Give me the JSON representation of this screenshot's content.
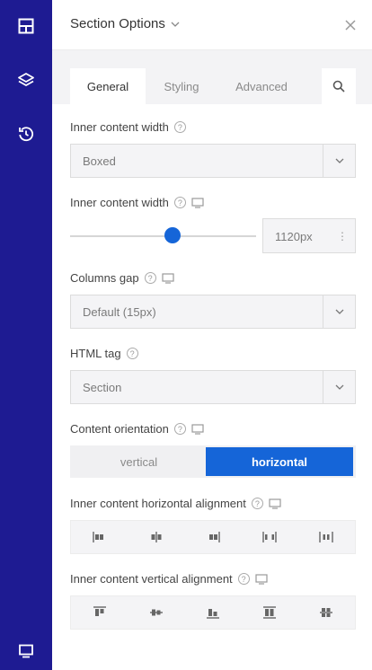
{
  "sidebar": {
    "items": [
      {
        "icon": "layout-icon"
      },
      {
        "icon": "layers-icon"
      },
      {
        "icon": "history-icon"
      }
    ],
    "bottom_icon": "responsive-preview-icon"
  },
  "header": {
    "title": "Section Options"
  },
  "tabs": [
    {
      "label": "General",
      "active": true
    },
    {
      "label": "Styling",
      "active": false
    },
    {
      "label": "Advanced",
      "active": false
    }
  ],
  "fields": {
    "content_width": {
      "label": "Inner content width",
      "value": "Boxed"
    },
    "content_width_px": {
      "label": "Inner content width",
      "value": "1120px",
      "slider_fraction": 0.55
    },
    "columns_gap": {
      "label": "Columns gap",
      "value": "Default (15px)"
    },
    "html_tag": {
      "label": "HTML tag",
      "value": "Section"
    },
    "orientation": {
      "label": "Content orientation",
      "options": [
        "vertical",
        "horizontal"
      ],
      "selected": "horizontal"
    },
    "h_align": {
      "label": "Inner content horizontal alignment"
    },
    "v_align": {
      "label": "Inner content vertical alignment"
    }
  },
  "colors": {
    "rail": "#1e1b92",
    "accent": "#1565d8"
  }
}
